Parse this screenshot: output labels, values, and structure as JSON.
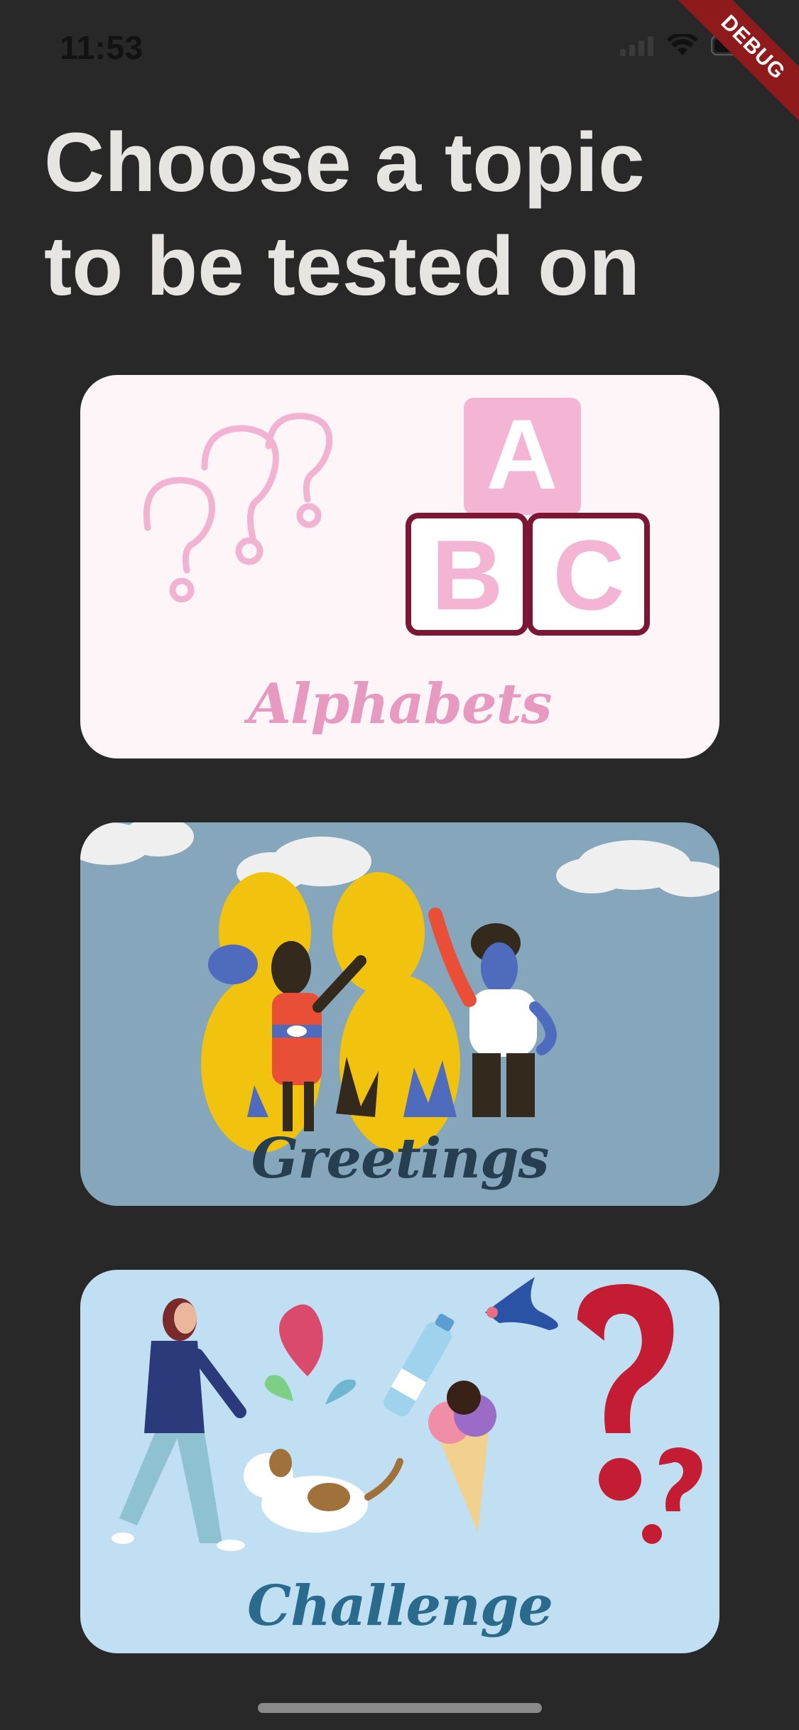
{
  "status_bar": {
    "time": "11:53"
  },
  "debug_banner": {
    "label": "DEBUG"
  },
  "header": {
    "title_line1": "Choose a topic",
    "title_line2": "to be tested on"
  },
  "topics": [
    {
      "label": "Alphabets",
      "background": "#fdf5f8",
      "label_color": "#e899bf"
    },
    {
      "label": "Greetings",
      "background": "#85a6bb",
      "label_color": "#253f50"
    },
    {
      "label": "Challenge",
      "background": "#c0dff2",
      "label_color": "#2a6b8d"
    }
  ],
  "alphabet_blocks": {
    "top": "A",
    "left": "B",
    "right": "C"
  },
  "icons": [
    "wifi-icon",
    "signal-icon",
    "battery-icon"
  ]
}
